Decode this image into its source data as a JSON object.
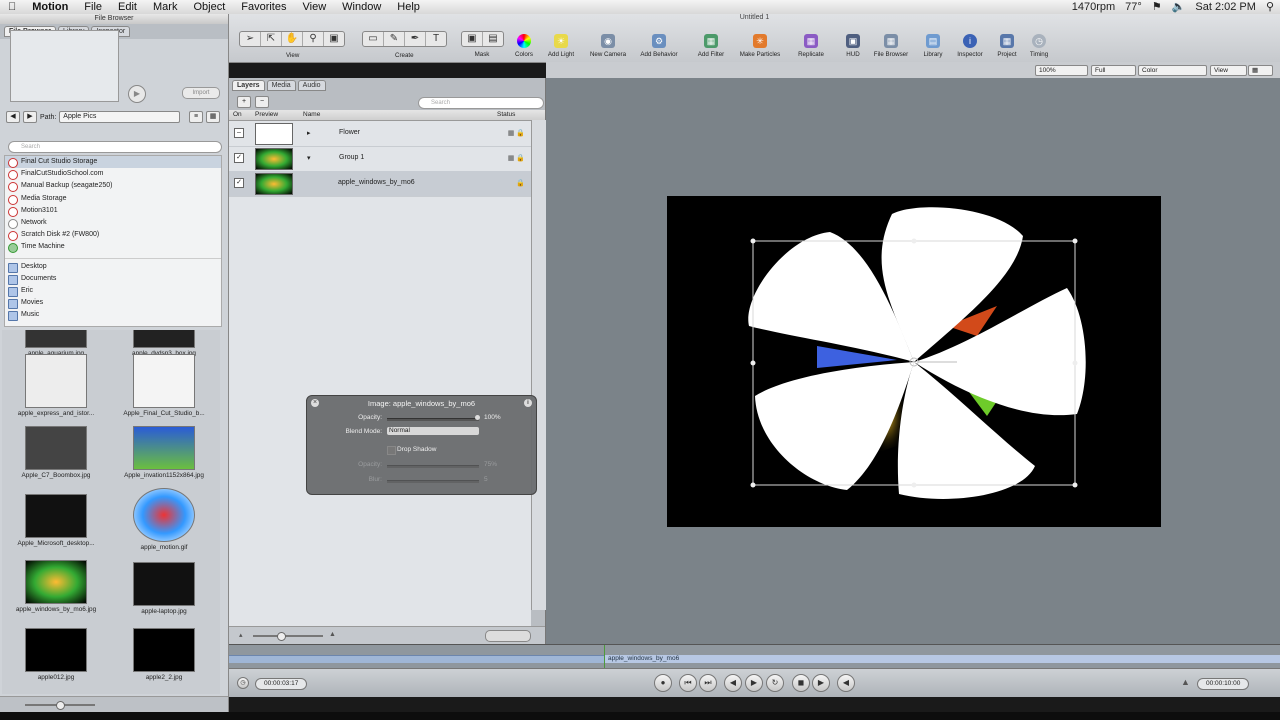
{
  "menubar": {
    "apple": "",
    "app": "Motion",
    "items": [
      "File",
      "Edit",
      "Mark",
      "Object",
      "Favorites",
      "View",
      "Window",
      "Help"
    ],
    "status_rpm": "1470rpm",
    "status_temp": "77°",
    "clock": "Sat 2:02 PM"
  },
  "file_browser": {
    "title": "File Browser",
    "tabs": [
      "File Browser",
      "Library",
      "Inspector"
    ],
    "import_label": "Import",
    "path_label": "Path:",
    "path_value": "Apple Pics",
    "search_placeholder": "Search",
    "sources": [
      "Final Cut Studio Storage",
      "FinalCutStudioSchool.com",
      "Manual Backup (seagate250)",
      "Media Storage",
      "Motion3101",
      "Network",
      "Scratch Disk #2   (FW800)",
      "Time Machine"
    ],
    "folders": [
      "Desktop",
      "Documents",
      "Eric",
      "Movies",
      "Music"
    ],
    "thumbs": [
      "apple_aquarium.jpg",
      "apple_dvdsp3_box.jpg",
      "apple_express_and_istor...",
      "Apple_Final_Cut_Studio_b...",
      "Apple_C7_Boombox.jpg",
      "Apple_invation1152x864.jpg",
      "Apple_Microsoft_desktop...",
      "apple_motion.gif",
      "apple_windows_by_mo6.jpg",
      "apple-laptop.jpg",
      "apple012.jpg",
      "apple2_2.jpg"
    ]
  },
  "toolbar": {
    "title": "Untitled 1",
    "view_label": "View",
    "create_label": "Create",
    "buttons": [
      "Mask",
      "Colors",
      "Add Light",
      "New Camera",
      "Add Behavior",
      "Add Filter",
      "Make Particles",
      "Replicate",
      "HUD",
      "File Browser",
      "Library",
      "Inspector",
      "Project",
      "Timing"
    ]
  },
  "canvas_bar": {
    "zoom": "100%",
    "resolution": "Full",
    "channels": "Color",
    "view": "View"
  },
  "layers": {
    "tabs": [
      "Layers",
      "Media",
      "Audio"
    ],
    "search_placeholder": "Search",
    "headers": {
      "on": "On",
      "preview": "Preview",
      "name": "Name",
      "status": "Status"
    },
    "rows": [
      "Flower",
      "Group 1",
      "apple_windows_by_mo6"
    ]
  },
  "hud": {
    "title": "Image: apple_windows_by_mo6",
    "opacity_label": "Opacity:",
    "opacity_value": "100%",
    "blend_label": "Blend Mode:",
    "blend_value": "Normal",
    "drop_shadow_label": "Drop Shadow",
    "shadow_opacity_label": "Opacity:",
    "shadow_opacity_value": "75%",
    "blur_label": "Blur:",
    "blur_value": "5"
  },
  "timeline": {
    "clip_name": "apple_windows_by_mo6",
    "current_time": "00:00:03:17",
    "duration": "00:00:10:00"
  },
  "colors": {
    "canvas_bg": "#7b8389",
    "stage_bg": "#000000",
    "selection": "#c9d3df"
  }
}
